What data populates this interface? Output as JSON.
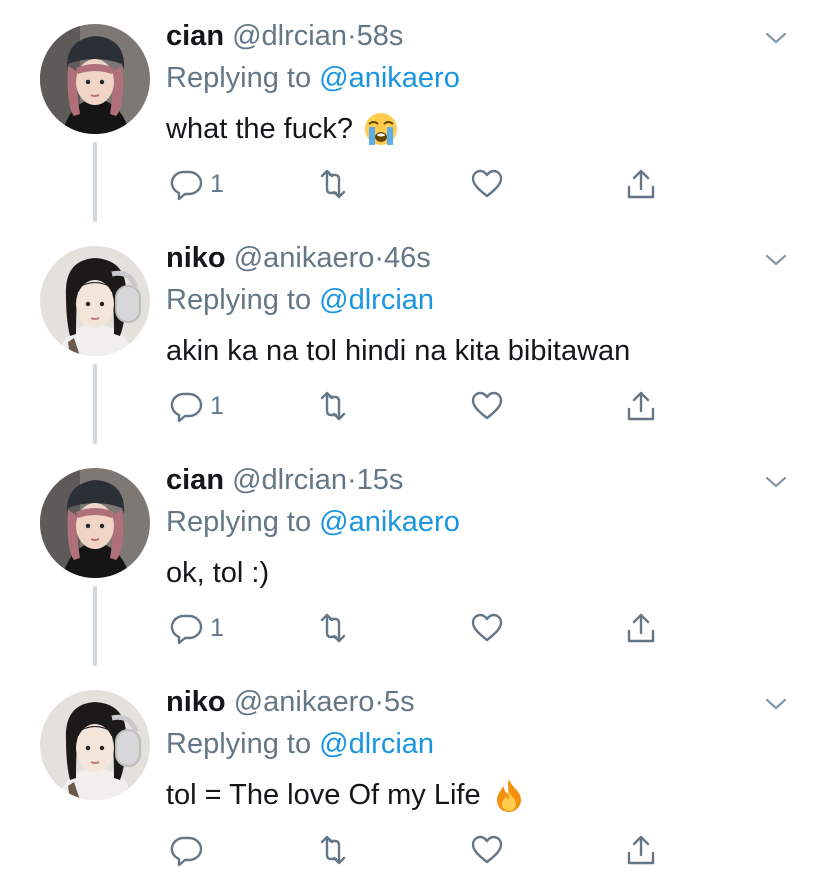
{
  "tweets": [
    {
      "name": "cian",
      "handle": "@dlrcian",
      "dot": "·",
      "time": "58s",
      "replying_prefix": "Replying to",
      "replying_to": "@anikaero",
      "text": "what the fuck?",
      "emoji": "loudly-crying-face",
      "reply_count": "1",
      "avatar": "cian-avatar"
    },
    {
      "name": "niko",
      "handle": "@anikaero",
      "dot": "·",
      "time": "46s",
      "replying_prefix": "Replying to",
      "replying_to": "@dlrcian",
      "text": "akin ka na tol hindi na kita bibitawan",
      "emoji": "",
      "reply_count": "1",
      "avatar": "niko-avatar"
    },
    {
      "name": "cian",
      "handle": "@dlrcian",
      "dot": "·",
      "time": "15s",
      "replying_prefix": "Replying to",
      "replying_to": "@anikaero",
      "text": "ok, tol :)",
      "emoji": "",
      "reply_count": "1",
      "avatar": "cian-avatar"
    },
    {
      "name": "niko",
      "handle": "@anikaero",
      "dot": "·",
      "time": "5s",
      "replying_prefix": "Replying to",
      "replying_to": "@dlrcian",
      "text": "tol = The love Of my Life",
      "emoji": "fire",
      "reply_count": "",
      "avatar": "niko-avatar"
    }
  ],
  "colors": {
    "accent": "#1b95e0",
    "secondary_text": "#657786",
    "primary_text": "#14171a",
    "thread_line": "#cfd9de"
  }
}
